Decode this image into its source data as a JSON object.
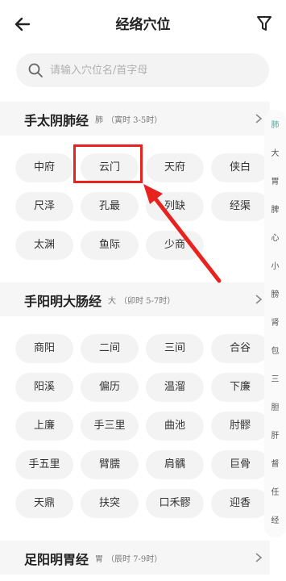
{
  "header": {
    "title": "经络穴位",
    "back_icon": "arrow-left-icon",
    "filter_icon": "filter-icon"
  },
  "search": {
    "placeholder": "请输入穴位名/首字母",
    "icon": "search-icon"
  },
  "sections": [
    {
      "name": "手太阴肺经",
      "short": "肺",
      "time": "（寅时 3-5时）",
      "points": [
        "中府",
        "云门",
        "天府",
        "侠白",
        "尺泽",
        "孔最",
        "列缺",
        "经渠",
        "太渊",
        "鱼际",
        "少商"
      ]
    },
    {
      "name": "手阳明大肠经",
      "short": "大",
      "time": "（卯时 5-7时）",
      "points": [
        "商阳",
        "二间",
        "三间",
        "合谷",
        "阳溪",
        "偏历",
        "温溜",
        "下廉",
        "上廉",
        "手三里",
        "曲池",
        "肘髎",
        "手五里",
        "臂臑",
        "肩髃",
        "巨骨",
        "天鼎",
        "扶突",
        "口禾髎",
        "迎香"
      ]
    },
    {
      "name": "足阳明胃经",
      "short": "胃",
      "time": "（辰时 7-9时）",
      "points": []
    }
  ],
  "index_bar": [
    "肺",
    "大",
    "胃",
    "脾",
    "心",
    "小",
    "膀",
    "肾",
    "包",
    "三",
    "胆",
    "肝",
    "督",
    "任",
    "经"
  ],
  "index_active": "肺",
  "annotation": {
    "highlighted_point": "云门",
    "color": "#e8221f"
  },
  "colors": {
    "accent": "#3bb5a3",
    "chip_bg": "#f3f3f3"
  }
}
